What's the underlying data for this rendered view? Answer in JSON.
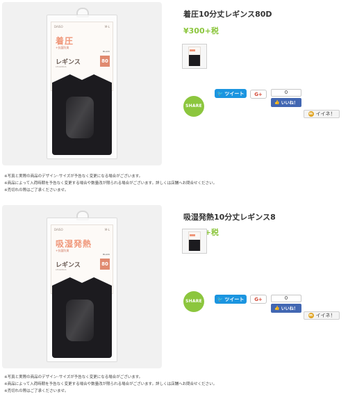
{
  "products": [
    {
      "title": "着圧10分丈レギンス80D",
      "price": "¥300+税",
      "package": {
        "brand_line": "DAISO",
        "size": "M-L",
        "headline": "着圧",
        "subline": "+抗菌防臭",
        "category": "レギンス",
        "category_sub": "LEGGINGS",
        "color_label": "BLACK",
        "denier": "80"
      },
      "share": {
        "badge": "SHARE",
        "tweet_label": "ツイート",
        "gplus_label": "G+",
        "fb_count": "0",
        "fb_like_label": "いいね！",
        "iine_label": "イイネ！"
      },
      "notes": [
        "※写真と実際の商品のデザイン･サイズが予告なく変更になる場合がございます。",
        "※商品によって入荷時期を予告なく変更する場合や数量改が限られる場合がございます。詳しくは店舗へお問合せください。",
        "※売切れの際はご了承くださいませ。"
      ]
    },
    {
      "title": "吸湿発熱10分丈レギンス8",
      "price": "¥300+税",
      "package": {
        "brand_line": "DAISO",
        "size": "M-L",
        "headline": "吸湿発熱",
        "subline": "+抗菌防臭",
        "category": "レギンス",
        "category_sub": "LEGGINGS",
        "color_label": "BLACK",
        "denier": "80"
      },
      "share": {
        "badge": "SHARE",
        "tweet_label": "ツイート",
        "gplus_label": "G+",
        "fb_count": "0",
        "fb_like_label": "いいね！",
        "iine_label": "イイネ！"
      },
      "notes": [
        "※写真と実際の商品のデザイン･サイズが予告なく変更になる場合がございます。",
        "※商品によって入荷時期を予告なく変更する場合や数量改が限られる場合がございます。詳しくは店舗へお問合せください。",
        "※売切れの際はご了承くださいませ。"
      ]
    }
  ],
  "colors": {
    "accent_green": "#8cc63e",
    "twitter_blue": "#1b95e0",
    "facebook_blue": "#4267b2",
    "package_pink": "#f0977a"
  }
}
